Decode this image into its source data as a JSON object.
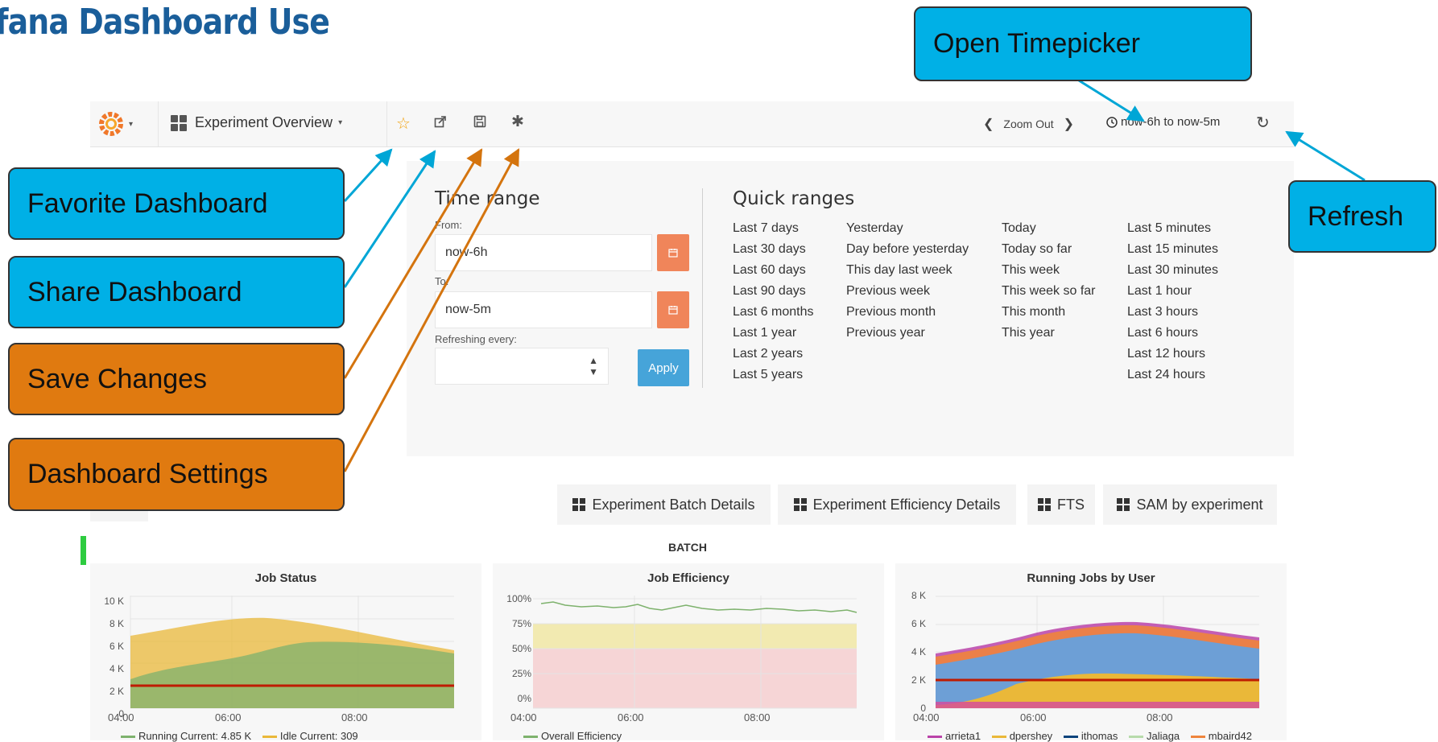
{
  "slide_title": "fana Dashboard Use",
  "navbar": {
    "dashboard_name": "Experiment Overview",
    "zoom_out": "Zoom Out",
    "time_range": "now-6h to now-5m"
  },
  "timepicker": {
    "time_range_title": "Time range",
    "from_label": "From:",
    "from_value": "now-6h",
    "to_label": "To:",
    "to_value": "now-5m",
    "refresh_label": "Refreshing every:",
    "apply_label": "Apply",
    "quick_ranges_title": "Quick ranges",
    "quick_ranges": [
      [
        "Last 7 days",
        "Last 30 days",
        "Last 60 days",
        "Last 90 days",
        "Last 6 months",
        "Last 1 year",
        "Last 2 years",
        "Last 5 years"
      ],
      [
        "Yesterday",
        "Day before yesterday",
        "This day last week",
        "Previous week",
        "Previous month",
        "Previous year"
      ],
      [
        "Today",
        "Today so far",
        "This week",
        "This week so far",
        "This month",
        "This year"
      ],
      [
        "Last 5 minutes",
        "Last 15 minutes",
        "Last 30 minutes",
        "Last 1 hour",
        "Last 3 hours",
        "Last 6 hours",
        "Last 12 hours",
        "Last 24 hours"
      ]
    ]
  },
  "row_buttons": [
    "Experiment Batch Details",
    "Experiment Efficiency Details",
    "FTS",
    "SAM by experiment"
  ],
  "batch_label": "BATCH",
  "panels": {
    "job_status": {
      "title": "Job Status",
      "y_ticks": [
        "10 K",
        "8 K",
        "6 K",
        "4 K",
        "2 K",
        "0"
      ],
      "x_ticks": [
        "04:00",
        "06:00",
        "08:00"
      ],
      "legend": [
        {
          "label": "Running  Current: 4.85 K",
          "color": "#7eb26d"
        },
        {
          "label": "Idle  Current: 309",
          "color": "#eab839"
        }
      ]
    },
    "job_efficiency": {
      "title": "Job Efficiency",
      "y_ticks": [
        "100%",
        "75%",
        "50%",
        "25%",
        "0%"
      ],
      "x_ticks": [
        "04:00",
        "06:00",
        "08:00"
      ],
      "legend": [
        {
          "label": "Overall Efficiency",
          "color": "#7eb26d"
        }
      ]
    },
    "running_jobs": {
      "title": "Running Jobs by User",
      "y_ticks": [
        "8 K",
        "6 K",
        "4 K",
        "2 K",
        "0"
      ],
      "x_ticks": [
        "04:00",
        "06:00",
        "08:00"
      ],
      "legend": [
        {
          "label": "arrieta1",
          "color": "#ba43a9"
        },
        {
          "label": "dpershey",
          "color": "#eab839"
        },
        {
          "label": "ithomas",
          "color": "#0a437c"
        },
        {
          "label": "Jaliaga",
          "color": "#b7dbab"
        },
        {
          "label": "mbaird42",
          "color": "#ef843c"
        }
      ]
    }
  },
  "callouts": {
    "open_timepicker": "Open Timepicker",
    "favorite": "Favorite Dashboard",
    "share": "Share Dashboard",
    "save": "Save Changes",
    "settings": "Dashboard Settings",
    "refresh": "Refresh"
  },
  "colors": {
    "callout_blue": "#00b0e6",
    "callout_orange": "#e07a10",
    "apply_button": "#46a4d9",
    "calendar_button": "#f0855a",
    "threshold_line": "#bf1b00",
    "star_icon": "#f2a20e"
  }
}
